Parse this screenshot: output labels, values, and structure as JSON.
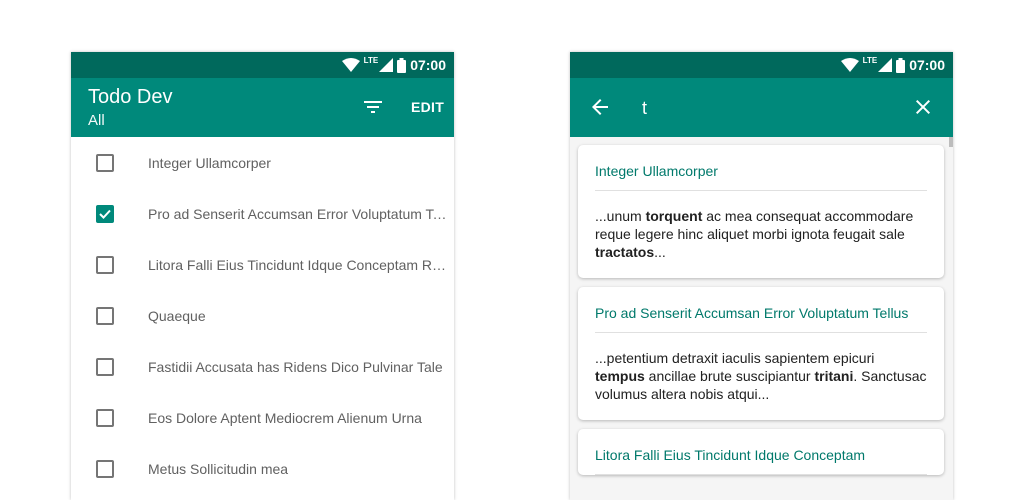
{
  "status_bar": {
    "time": "07:00",
    "network": "LTE"
  },
  "left": {
    "app_title": "Todo Dev",
    "app_subtitle": "All",
    "edit_label": "EDIT",
    "todos": [
      {
        "label": "Integer Ullamcorper",
        "checked": false
      },
      {
        "label": "Pro ad Senserit Accumsan Error Voluptatum Tellus",
        "checked": true
      },
      {
        "label": "Litora Falli Eius Tincidunt Idque Conceptam Reque",
        "checked": false
      },
      {
        "label": "Quaeque",
        "checked": false
      },
      {
        "label": "Fastidii Accusata has Ridens Dico Pulvinar Tale",
        "checked": false
      },
      {
        "label": "Eos Dolore Aptent Mediocrem Alienum Urna",
        "checked": false
      },
      {
        "label": "Metus Sollicitudin mea",
        "checked": false
      }
    ]
  },
  "right": {
    "search_value": "t",
    "results": [
      {
        "title": "Integer Ullamcorper",
        "snippet": [
          {
            "text": "...unum ",
            "bold": false
          },
          {
            "text": "torquent",
            "bold": true
          },
          {
            "text": " ac mea consequat accommodare reque legere hinc aliquet morbi ignota feugait sale ",
            "bold": false
          },
          {
            "text": "tractatos",
            "bold": true
          },
          {
            "text": "...",
            "bold": false
          }
        ]
      },
      {
        "title": "Pro ad Senserit Accumsan Error Voluptatum Tellus",
        "snippet": [
          {
            "text": "...petentium detraxit iaculis sapientem epicuri ",
            "bold": false
          },
          {
            "text": "tempus",
            "bold": true
          },
          {
            "text": " ancillae brute suscipiantur ",
            "bold": false
          },
          {
            "text": "tritani",
            "bold": true
          },
          {
            "text": ". Sanctusac volumus altera nobis atqui...",
            "bold": false
          }
        ]
      },
      {
        "title": "Litora Falli Eius Tincidunt Idque Conceptam",
        "snippet": []
      }
    ]
  },
  "icons": {
    "wifi": "wifi-icon",
    "signal": "signal-icon",
    "battery": "battery-icon",
    "filter": "filter-icon",
    "back": "arrow-back-icon",
    "close": "close-icon",
    "check": "check-icon"
  },
  "colors": {
    "status_bar": "#00695c",
    "app_bar": "#00897b",
    "accent_text": "#00796b"
  }
}
